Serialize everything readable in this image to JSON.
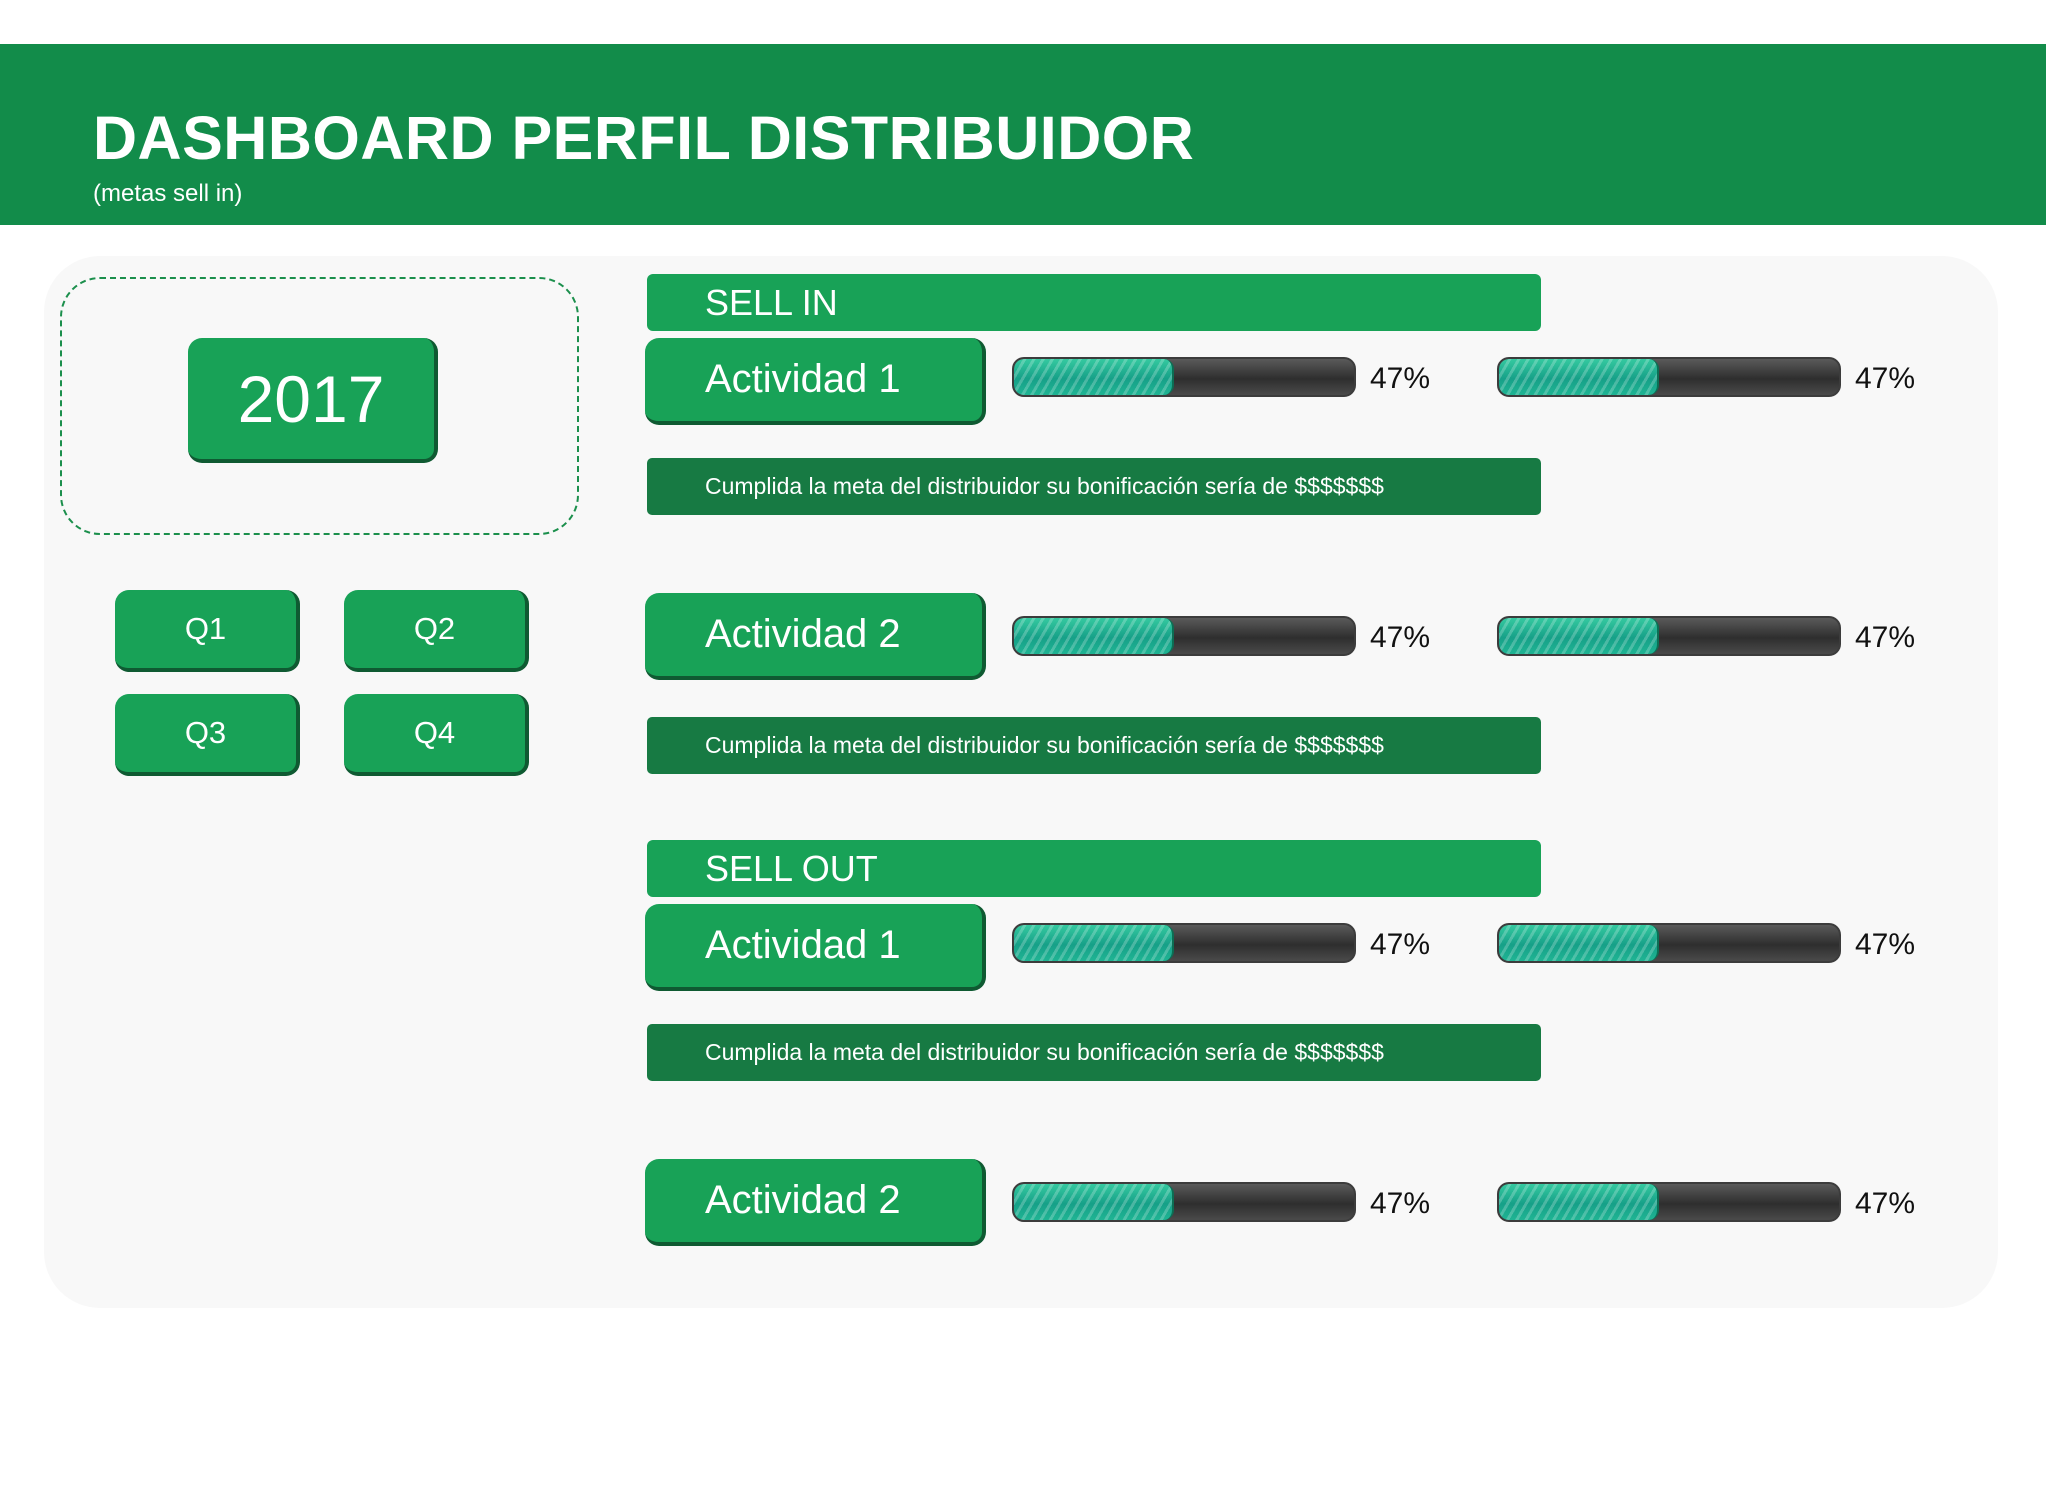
{
  "header": {
    "title": "DASHBOARD PERFIL DISTRIBUIDOR",
    "subtitle": "(metas sell in)",
    "background_color": "#128c4a"
  },
  "year_selector": {
    "label": "2017"
  },
  "quarters": [
    "Q1",
    "Q2",
    "Q3",
    "Q4"
  ],
  "sections": [
    {
      "title": "SELL IN",
      "activities": [
        {
          "label": "Actividad 1",
          "progress": [
            {
              "value": 0.47,
              "label": "47%"
            },
            {
              "value": 0.47,
              "label": "47%"
            }
          ],
          "note": "Cumplida la meta del distribuidor su bonificación sería de $$$$$$$"
        },
        {
          "label": "Actividad 2",
          "progress": [
            {
              "value": 0.47,
              "label": "47%"
            },
            {
              "value": 0.47,
              "label": "47%"
            }
          ],
          "note": "Cumplida la meta del distribuidor su bonificación sería de $$$$$$$"
        }
      ]
    },
    {
      "title": "SELL OUT",
      "activities": [
        {
          "label": "Actividad 1",
          "progress": [
            {
              "value": 0.47,
              "label": "47%"
            },
            {
              "value": 0.47,
              "label": "47%"
            }
          ],
          "note": "Cumplida la meta del distribuidor su bonificación sería de $$$$$$$"
        },
        {
          "label": "Actividad 2",
          "progress": [
            {
              "value": 0.47,
              "label": "47%"
            },
            {
              "value": 0.47,
              "label": "47%"
            }
          ]
        }
      ]
    }
  ],
  "colors": {
    "button_green": "#18a257",
    "note_green": "#177a43",
    "progress_fill": "#16a088",
    "progress_track": "#333333"
  }
}
